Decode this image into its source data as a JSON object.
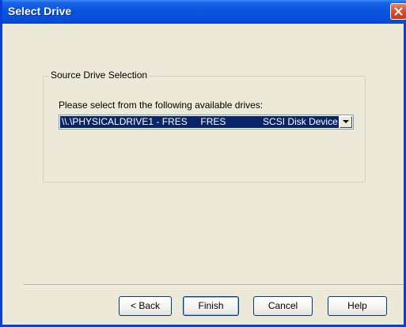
{
  "window": {
    "title": "Select Drive"
  },
  "source_group": {
    "label": "Source Drive Selection",
    "prompt": "Please select from the following available drives:",
    "selected_drive": "\\\\.\\PHYSICALDRIVE1 - FRES     FRES              SCSI Disk Device"
  },
  "buttons": {
    "back": "< Back",
    "finish": "Finish",
    "cancel": "Cancel",
    "help": "Help"
  },
  "colors": {
    "titlebar": "#0a54e0",
    "selection": "#0a246a",
    "background": "#ece9d8"
  }
}
